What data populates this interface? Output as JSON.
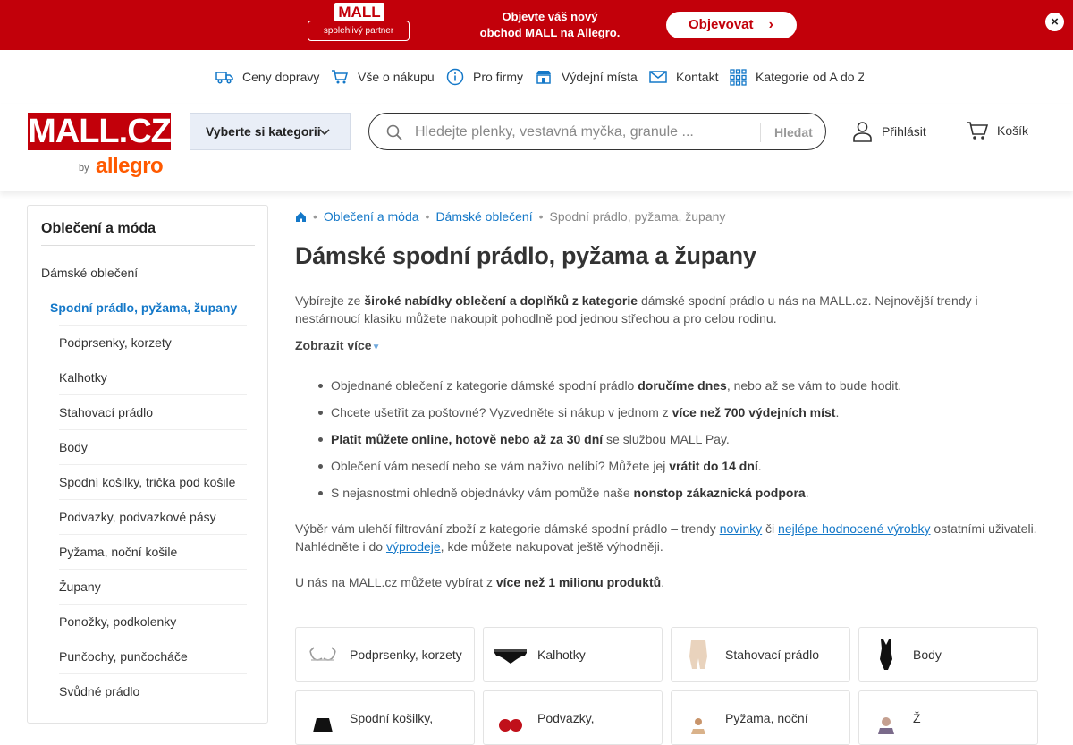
{
  "promo": {
    "logo": "MALL",
    "tagline": "spolehlivý partner",
    "text_line1": "Objevte váš nový",
    "text_line2": "obchod MALL na Allegro.",
    "button": "Objevovat",
    "close": "×"
  },
  "services": [
    {
      "label": "Ceny dopravy",
      "icon": "truck-icon"
    },
    {
      "label": "Vše o nákupu",
      "icon": "cart-icon"
    },
    {
      "label": "Pro firmy",
      "icon": "info-icon"
    },
    {
      "label": "Výdejní místa",
      "icon": "store-icon"
    },
    {
      "label": "Kontakt",
      "icon": "mail-icon"
    },
    {
      "label": "Kategorie od A do Z",
      "icon": "grid-icon"
    }
  ],
  "header": {
    "logo": "MALL.CZ",
    "by": "by",
    "allegro": "allegro",
    "category_button": "Vyberte si kategorii",
    "search_placeholder": "Hledejte plenky, vestavná myčka, granule ...",
    "search_button": "Hledat",
    "login": "Přihlásit",
    "cart": "Košík"
  },
  "sidebar": {
    "title": "Oblečení a móda",
    "items": [
      {
        "label": "Dámské oblečení",
        "level": 0
      },
      {
        "label": "Spodní prádlo, pyžama, župany",
        "level": 1,
        "active": true
      },
      {
        "label": "Podprsenky, korzety",
        "level": 2
      },
      {
        "label": "Kalhotky",
        "level": 2
      },
      {
        "label": "Stahovací prádlo",
        "level": 2
      },
      {
        "label": "Body",
        "level": 2
      },
      {
        "label": "Spodní košilky, trička pod košile",
        "level": 2
      },
      {
        "label": "Podvazky, podvazkové pásy",
        "level": 2
      },
      {
        "label": "Pyžama, noční košile",
        "level": 2
      },
      {
        "label": "Župany",
        "level": 2
      },
      {
        "label": "Ponožky, podkolenky",
        "level": 2
      },
      {
        "label": "Punčochy, punčocháče",
        "level": 2
      },
      {
        "label": "Svůdné prádlo",
        "level": 2
      }
    ]
  },
  "breadcrumb": {
    "home": "home-icon",
    "items": [
      "Oblečení a móda",
      "Dámské oblečení"
    ],
    "current": "Spodní prádlo, pyžama, župany"
  },
  "main": {
    "title": "Dámské spodní prádlo, pyžama a župany",
    "intro_1": "Vybírejte ze ",
    "intro_b": "široké nabídky oblečení a doplňků z kategorie",
    "intro_2": " dámské spodní prádlo u nás na MALL.cz. Nejnovější trendy i nestárnoucí klasiku můžete nakoupit pohodlně pod jednou střechou a pro celou rodinu.",
    "show_more": "Zobrazit více",
    "bullets": [
      {
        "pre": "Objednané oblečení z kategorie dámské spodní prádlo ",
        "bold": "doručíme dnes",
        "post": ", nebo až se vám to bude hodit."
      },
      {
        "pre": "Chcete ušetřit za poštovné? Vyzvedněte si nákup v jednom z ",
        "bold": "více než 700 výdejních míst",
        "post": "."
      },
      {
        "pre": "",
        "bold": "Platit můžete online, hotově nebo až za 30 dní",
        "post": " se službou MALL Pay."
      },
      {
        "pre": "Oblečení vám nesedí nebo se vám naživo nelíbí? Můžete jej ",
        "bold": "vrátit do 14 dní",
        "post": "."
      },
      {
        "pre": "S nejasnostmi ohledně objednávky vám pomůže naše ",
        "bold": "nonstop zákaznická podpora",
        "post": "."
      }
    ],
    "filter_1": "Výběr vám ulehčí filtrování zboží z kategorie dámské spodní prádlo – trendy ",
    "filter_link1": "novinky",
    "filter_2": " či ",
    "filter_link2": "nejlépe hodnocené výrobky",
    "filter_3": " ostatními uživateli. Nahlédněte i do ",
    "filter_link3": "výprodeje",
    "filter_4": ", kde můžete nakupovat ještě výhodněji.",
    "count_1": "U nás na MALL.cz můžete vybírat z ",
    "count_b": "více než 1 milionu produktů",
    "count_2": "."
  },
  "tiles": [
    {
      "label": "Podprsenky, korzety",
      "icon": "bra-icon"
    },
    {
      "label": "Kalhotky",
      "icon": "panties-icon"
    },
    {
      "label": "Stahovací prádlo",
      "icon": "shapewear-icon"
    },
    {
      "label": "Body",
      "icon": "bodysuit-icon"
    },
    {
      "label": "Spodní košilky,",
      "icon": "camisole-icon"
    },
    {
      "label": "Podvazky,",
      "icon": "garter-icon"
    },
    {
      "label": "Pyžama, noční",
      "icon": "pajamas-icon"
    },
    {
      "label": "Ž",
      "icon": "robe-icon"
    }
  ],
  "colors": {
    "brand": "#c2000a",
    "link": "#1478c8",
    "allegro": "#ff5a00"
  }
}
